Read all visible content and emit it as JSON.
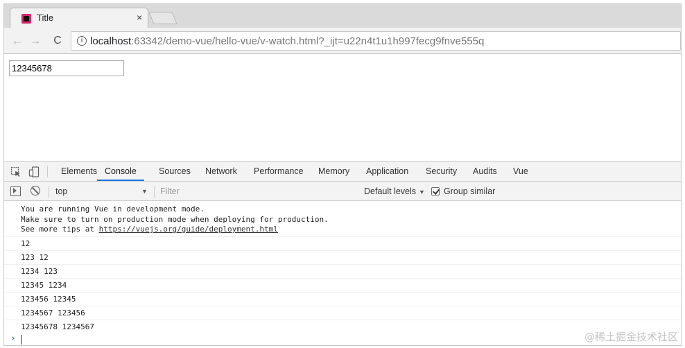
{
  "browser": {
    "tab_title": "Title",
    "tab_close": "×",
    "url_host": "localhost",
    "url_rest": ":63342/demo-vue/hello-vue/v-watch.html?_ijt=u22n4t1u1h997fecg9fnve555q"
  },
  "page": {
    "input_value": "12345678"
  },
  "devtools": {
    "tabs": [
      "Elements",
      "Console",
      "Sources",
      "Network",
      "Performance",
      "Memory",
      "Application",
      "Security",
      "Audits",
      "Vue"
    ],
    "active_tab": "Console",
    "context": "top",
    "filter_placeholder": "Filter",
    "levels": "Default levels",
    "group_similar": "Group similar",
    "group_similar_checked": true
  },
  "console": {
    "vue_message": {
      "line1": "You are running Vue in development mode.",
      "line2": "Make sure to turn on production mode when deploying for production.",
      "line3_prefix": "See more tips at ",
      "link": "https://vuejs.org/guide/deployment.html"
    },
    "logs": [
      "12",
      "123 12",
      "1234 123",
      "12345 1234",
      "123456 12345",
      "1234567 123456",
      "12345678 1234567"
    ],
    "prompt_symbol": "›"
  },
  "watermark": "@稀土掘金技术社区"
}
